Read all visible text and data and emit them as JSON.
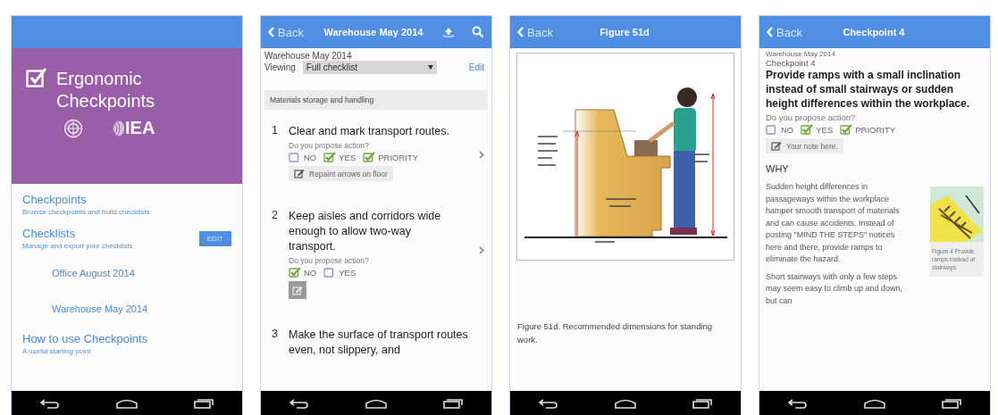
{
  "home_screen": {
    "app_title": "Ergonomic Checkpoints",
    "logo_text": "IEA",
    "menu": [
      {
        "title": "Checkpoints",
        "subtitle": "Browse checkpoints and build checklists"
      },
      {
        "title": "Checklists",
        "subtitle": "Manage and export your checklists",
        "action": "EDIT",
        "children": [
          {
            "title": "Office August 2014"
          },
          {
            "title": "Warehouse May 2014"
          }
        ]
      },
      {
        "title": "How to use Checkpoints",
        "subtitle": "A useful starting point"
      }
    ]
  },
  "checklist_screen": {
    "back": "Back",
    "title": "Warehouse May 2014",
    "checklist_name": "Warehouse May 2014",
    "viewing_label": "Viewing",
    "viewing_value": "Full checklist",
    "edit": "Edit",
    "section": "Materials storage and handling",
    "items": [
      {
        "number": "1",
        "text": "Clear and mark transport routes.",
        "question": "Do you propose action?",
        "options": [
          {
            "label": "NO",
            "checked": false
          },
          {
            "label": "YES",
            "checked": true
          },
          {
            "label": "PRIORITY",
            "checked": true
          }
        ],
        "note": "Repaint arrows on floor"
      },
      {
        "number": "2",
        "text": "Keep aisles and corridors wide enough to allow two-way transport.",
        "question": "Do you propose action?",
        "options": [
          {
            "label": "NO",
            "checked": true
          },
          {
            "label": "YES",
            "checked": false
          }
        ]
      },
      {
        "number": "3",
        "text": "Make the surface of transport routes even, not slippery, and"
      }
    ]
  },
  "figure_screen": {
    "back": "Back",
    "title": "Figure 51d",
    "caption": "Figure 51d. Recommended dimensions for standing work."
  },
  "checkpoint_screen": {
    "back": "Back",
    "title": "Checkpoint 4",
    "checklist_name": "Warehouse May 2014",
    "checkpoint_label": "Checkpoint 4",
    "heading": "Provide ramps with a small inclination instead of small stairways or sudden height differences within the workplace.",
    "question": "Do you propose action?",
    "options": [
      {
        "label": "NO",
        "checked": false
      },
      {
        "label": "YES",
        "checked": true
      },
      {
        "label": "PRIORITY",
        "checked": true
      }
    ],
    "note": "Your note here.",
    "why_heading": "WHY",
    "paragraphs": [
      "Sudden height differences in passageways within the workplace hamper smooth transport of materials and can cause accidents. Instead of posting \"MIND THE STEPS\" notices here and there, provide ramps to eliminate the hazard.",
      "Short stairways with only a few steps may seem easy to climb up and down, but can"
    ],
    "figure_caption": "Figure 4 Provide ramps instead of stairways"
  }
}
